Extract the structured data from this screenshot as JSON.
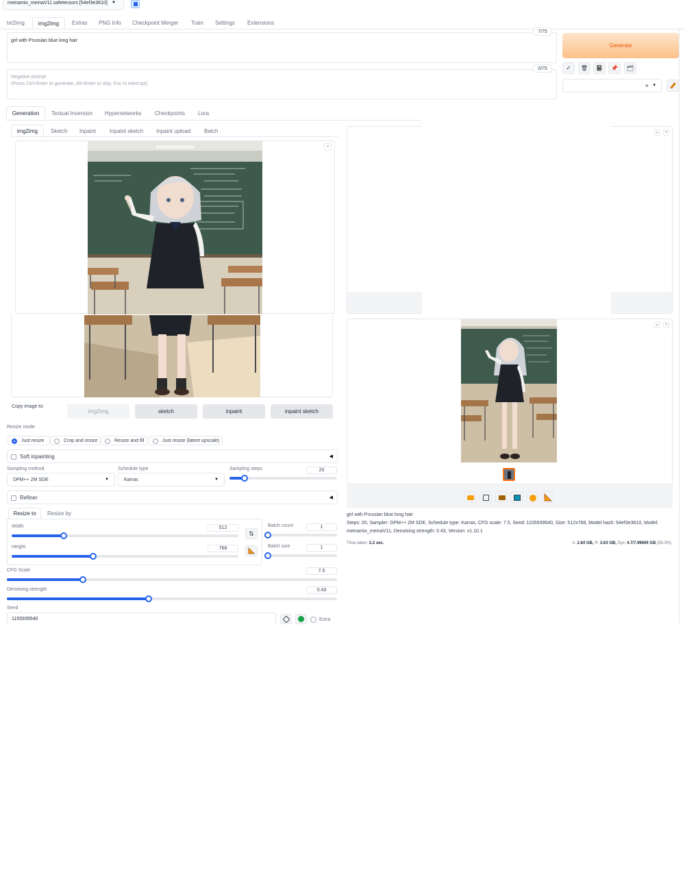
{
  "checkpoint": {
    "value": "meinamix_meinaV11.safetensors [54ef3e3610]"
  },
  "main_tabs": [
    "txt2img",
    "img2img",
    "Extras",
    "PNG Info",
    "Checkpoint Merger",
    "Train",
    "Settings",
    "Extensions"
  ],
  "prompt": {
    "value": "girl with Prussian blue long hair",
    "token_count": "7/75"
  },
  "negative_prompt": {
    "label": "Negative prompt",
    "placeholder": "(Press Ctrl+Enter to generate, Alt+Enter to skip, Esc to interrupt)",
    "token_count": "0/75"
  },
  "generate_label": "Generate",
  "style_buttons": {
    "check": "✓",
    "trash": "🗑",
    "notebook": "📓",
    "pin": "📌",
    "card": "🗂"
  },
  "style_select": {
    "clear": "×",
    "caret": "▾"
  },
  "sub_tabs": [
    "Generation",
    "Textual Inversion",
    "Hypernetworks",
    "Checkpoints",
    "Lora"
  ],
  "img_tabs": [
    "img2img",
    "Sketch",
    "Inpaint",
    "Inpaint sketch",
    "Inpaint upload",
    "Batch"
  ],
  "close_glyph": "×",
  "copy_image": {
    "label": "Copy image to:",
    "buttons": [
      "img2img",
      "sketch",
      "inpaint",
      "inpaint sketch"
    ]
  },
  "resize_mode": {
    "label": "Resize mode",
    "options": [
      "Just resize",
      "Crop and resize",
      "Resize and fill",
      "Just resize (latent upscale)"
    ],
    "selected": 0
  },
  "soft_inpainting": {
    "label": "Soft inpainting",
    "arrow": "◀"
  },
  "sampling_method": {
    "label": "Sampling method",
    "value": "DPM++ 2M SDE"
  },
  "schedule_type": {
    "label": "Schedule type",
    "value": "Karras"
  },
  "sampling_steps": {
    "label": "Sampling steps",
    "value": "20",
    "fraction": 0.14
  },
  "refiner": {
    "label": "Refiner",
    "arrow": "◀"
  },
  "resize_tabs": [
    "Resize to",
    "Resize by"
  ],
  "width": {
    "label": "Width",
    "value": "512",
    "fraction": 0.23
  },
  "height": {
    "label": "Height",
    "value": "768",
    "fraction": 0.36
  },
  "swap_icon": "⇅",
  "batch_count": {
    "label": "Batch count",
    "value": "1",
    "fraction": 0.0
  },
  "batch_size": {
    "label": "Batch size",
    "value": "1",
    "fraction": 0.0
  },
  "cfg_scale": {
    "label": "CFG Scale",
    "value": "7.5",
    "fraction": 0.23
  },
  "denoising": {
    "label": "Denoising strength",
    "value": "0.43",
    "fraction": 0.43
  },
  "seed": {
    "label": "Seed",
    "value": "1155939540",
    "extra_label": "Extra"
  },
  "output": {
    "prompt_line": "girl with Prussian blue long hair",
    "params_line1": "Steps: 20, Sampler: DPM++ 2M SDE, Schedule type: Karras, CFG scale: 7.5, Seed: 1155939540, Size: 512x768, Model hash: 54ef3e3610, Model:",
    "params_line2": "meinamix_meinaV11, Denoising strength: 0.43, Version: v1.10.1",
    "time_label": "Time taken:",
    "time_value": "2.2 sec.",
    "vram_a_label": "A:",
    "vram_a": "2.84 GB,",
    "vram_r_label": "R:",
    "vram_r": "3.63 GB,",
    "vram_sys_label": "Sys:",
    "vram_sys": "4.7/7.99609 GB",
    "vram_pct": "(59.3%)"
  },
  "colors": {
    "accent": "#2563eb",
    "generate_start": "#fde0c2",
    "generate_end": "#fdba74",
    "generate_text": "#ea580c",
    "selected_thumb": "#f97316"
  }
}
